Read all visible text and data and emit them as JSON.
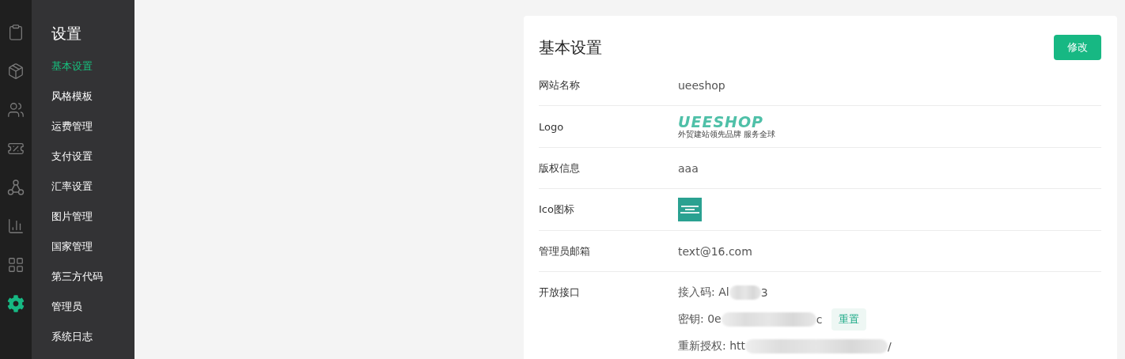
{
  "rail": [
    {
      "kind": "clipboard",
      "selected": false
    },
    {
      "kind": "box",
      "selected": false
    },
    {
      "kind": "users",
      "selected": false
    },
    {
      "kind": "ticket",
      "selected": false
    },
    {
      "kind": "nodes",
      "selected": false
    },
    {
      "kind": "chart",
      "selected": false
    },
    {
      "kind": "apps",
      "selected": false
    },
    {
      "kind": "gear",
      "selected": true
    }
  ],
  "sidebar": {
    "title": "设置",
    "items": [
      {
        "label": "基本设置",
        "selected": true
      },
      {
        "label": "风格模板",
        "selected": false
      },
      {
        "label": "运费管理",
        "selected": false
      },
      {
        "label": "支付设置",
        "selected": false
      },
      {
        "label": "汇率设置",
        "selected": false
      },
      {
        "label": "图片管理",
        "selected": false
      },
      {
        "label": "国家管理",
        "selected": false
      },
      {
        "label": "第三方代码",
        "selected": false
      },
      {
        "label": "管理员",
        "selected": false
      },
      {
        "label": "系统日志",
        "selected": false
      }
    ]
  },
  "card": {
    "title": "基本设置",
    "edit_button": "修改",
    "rows": [
      {
        "kind": "text",
        "label": "网站名称",
        "value": "ueeshop"
      },
      {
        "kind": "logo",
        "label": "Logo",
        "logo_text": "UEESHOP",
        "logo_tagline": "外贸建站领先品牌 服务全球"
      },
      {
        "kind": "text",
        "label": "版权信息",
        "value": "aaa"
      },
      {
        "kind": "icon",
        "label": "Ico图标"
      },
      {
        "kind": "text",
        "label": "管理员邮箱",
        "value": "text@16.com"
      },
      {
        "kind": "api",
        "label": "开放接口",
        "lines": [
          {
            "head": "接入码: Al",
            "tail": "3"
          },
          {
            "head": "密钥: 0e",
            "tail": "c",
            "button": "重置"
          },
          {
            "head": "重新授权: htt",
            "tail": "/"
          }
        ]
      }
    ]
  }
}
